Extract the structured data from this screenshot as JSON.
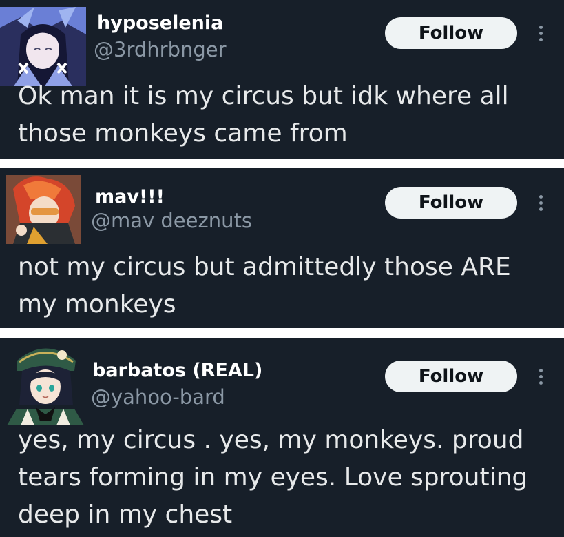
{
  "posts": [
    {
      "display_name": "hyposelenia",
      "handle": "@3rdhrbnger",
      "follow_label": "Follow",
      "text": "Ok man it is my circus but idk where all those monkeys came from"
    },
    {
      "display_name": "mav!!!",
      "handle": "@mav deeznuts",
      "follow_label": "Follow",
      "text": "not my circus but admittedly those ARE my monkeys"
    },
    {
      "display_name": "barbatos (REAL)",
      "handle": "@yahoo-bard",
      "follow_label": "Follow",
      "text": "yes, my circus . yes, my monkeys. proud tears forming in my eyes. Love  sprouting deep in my chest"
    }
  ],
  "colors": {
    "background": "#171f29",
    "separator": "#ffffff",
    "follow_button_bg": "#eff3f4",
    "handle_text": "#8b98a5",
    "body_text": "#e7e9ea"
  },
  "icons": {
    "more": "more-vertical-icon"
  }
}
